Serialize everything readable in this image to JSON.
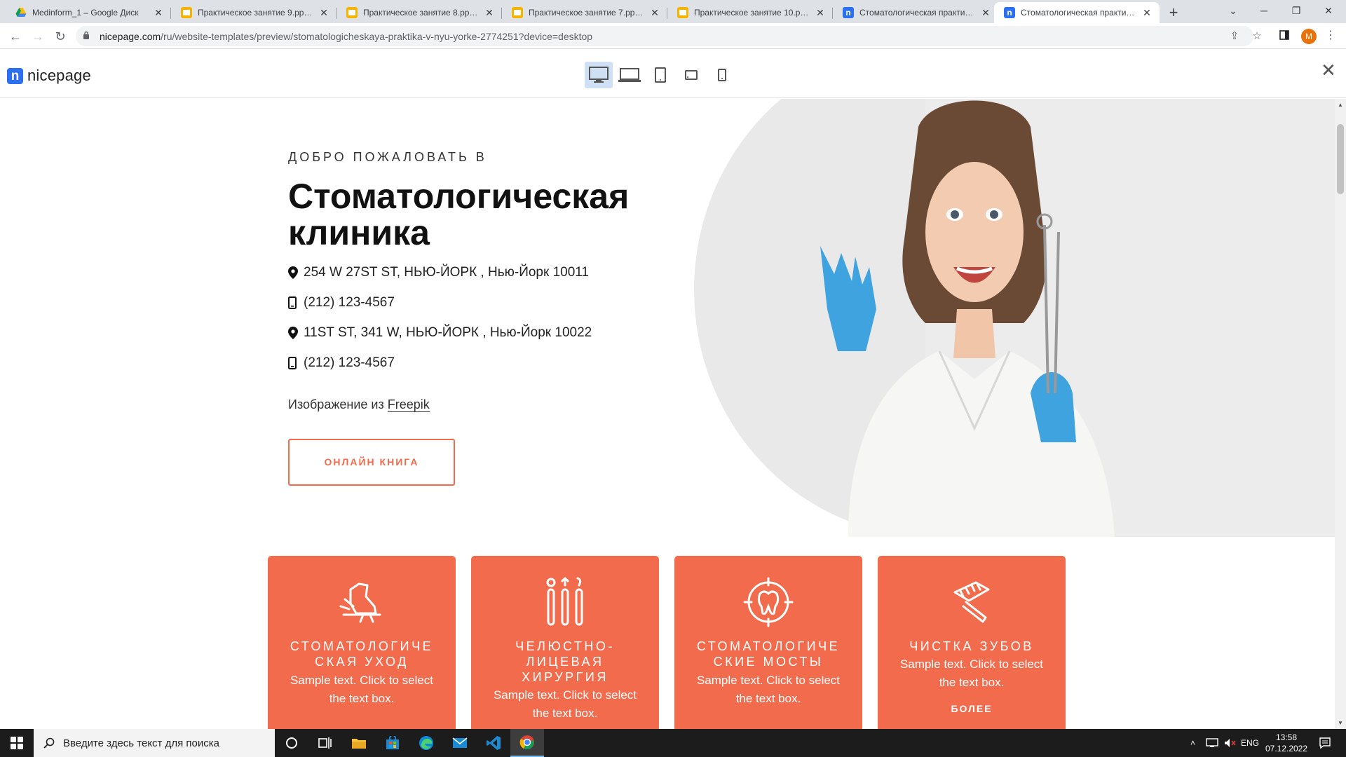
{
  "browser": {
    "tabs": [
      {
        "title": "Medinform_1 – Google Диск",
        "icon": "google-drive-icon"
      },
      {
        "title": "Практическое занятие 9.pptx - ",
        "icon": "slides-icon"
      },
      {
        "title": "Практическое занятие 8.pptx - ",
        "icon": "slides-icon"
      },
      {
        "title": "Практическое занятие 7.pptx - ",
        "icon": "slides-icon"
      },
      {
        "title": "Практическое занятие 10.pptx",
        "icon": "slides-icon"
      },
      {
        "title": "Стоматологическая практика в",
        "icon": "nicepage-icon"
      },
      {
        "title": "Стоматологическая практика в",
        "icon": "nicepage-icon",
        "active": true
      }
    ],
    "url_host": "nicepage.com",
    "url_path": "/ru/website-templates/preview/stomatologicheskaya-praktika-v-nyu-yorke-2774251?device=desktop",
    "profile_initial": "M"
  },
  "nicepage": {
    "logo_mark": "n",
    "logo_text": "nicepage",
    "devices": [
      "desktop-icon",
      "laptop-icon",
      "tablet-icon",
      "tablet-landscape-icon",
      "phone-icon"
    ],
    "active_device": "desktop-icon"
  },
  "hero": {
    "welcome": "ДОБРО ПОЖАЛОВАТЬ В",
    "title": "Стоматологическая клиника",
    "contacts": [
      {
        "icon": "location-pin-icon",
        "text": "254 W 27ST ST, НЬЮ-ЙОРК , Нью-Йорк 10011"
      },
      {
        "icon": "phone-icon",
        "text": "(212) 123-4567"
      },
      {
        "icon": "location-pin-icon",
        "text": "11ST ST, 341 W, НЬЮ-ЙОРК , Нью-Йорк 10022"
      },
      {
        "icon": "phone-icon",
        "text": "(212) 123-4567"
      }
    ],
    "credit_prefix": "Изображение из ",
    "credit_link": "Freepik",
    "button": "ОНЛАЙН КНИГА"
  },
  "cards": [
    {
      "icon": "dental-chair-icon",
      "title": "СТОМАТОЛОГИЧЕ СКАЯ УХОД",
      "text": "Sample text. Click to select the text box."
    },
    {
      "icon": "dental-tools-icon",
      "title": "ЧЕЛЮСТНО-ЛИЦЕВАЯ ХИРУРГИЯ",
      "text": "Sample text. Click to select the text box."
    },
    {
      "icon": "tooth-target-icon",
      "title": "СТОМАТОЛОГИЧЕ СКИЕ МОСТЫ",
      "text": "Sample text. Click to select the text box."
    },
    {
      "icon": "toothbrush-icon",
      "title": "ЧИСТКА ЗУБОВ",
      "text": "Sample text. Click to select the text box.",
      "more": "БОЛЕЕ"
    }
  ],
  "taskbar": {
    "search_placeholder": "Введите здесь текст для поиска",
    "lang": "ENG",
    "time": "13:58",
    "date": "07.12.2022"
  },
  "colors": {
    "accent": "#f26b4c",
    "nicepage_blue": "#2b6ff3",
    "taskbar": "#1c1c1c"
  }
}
